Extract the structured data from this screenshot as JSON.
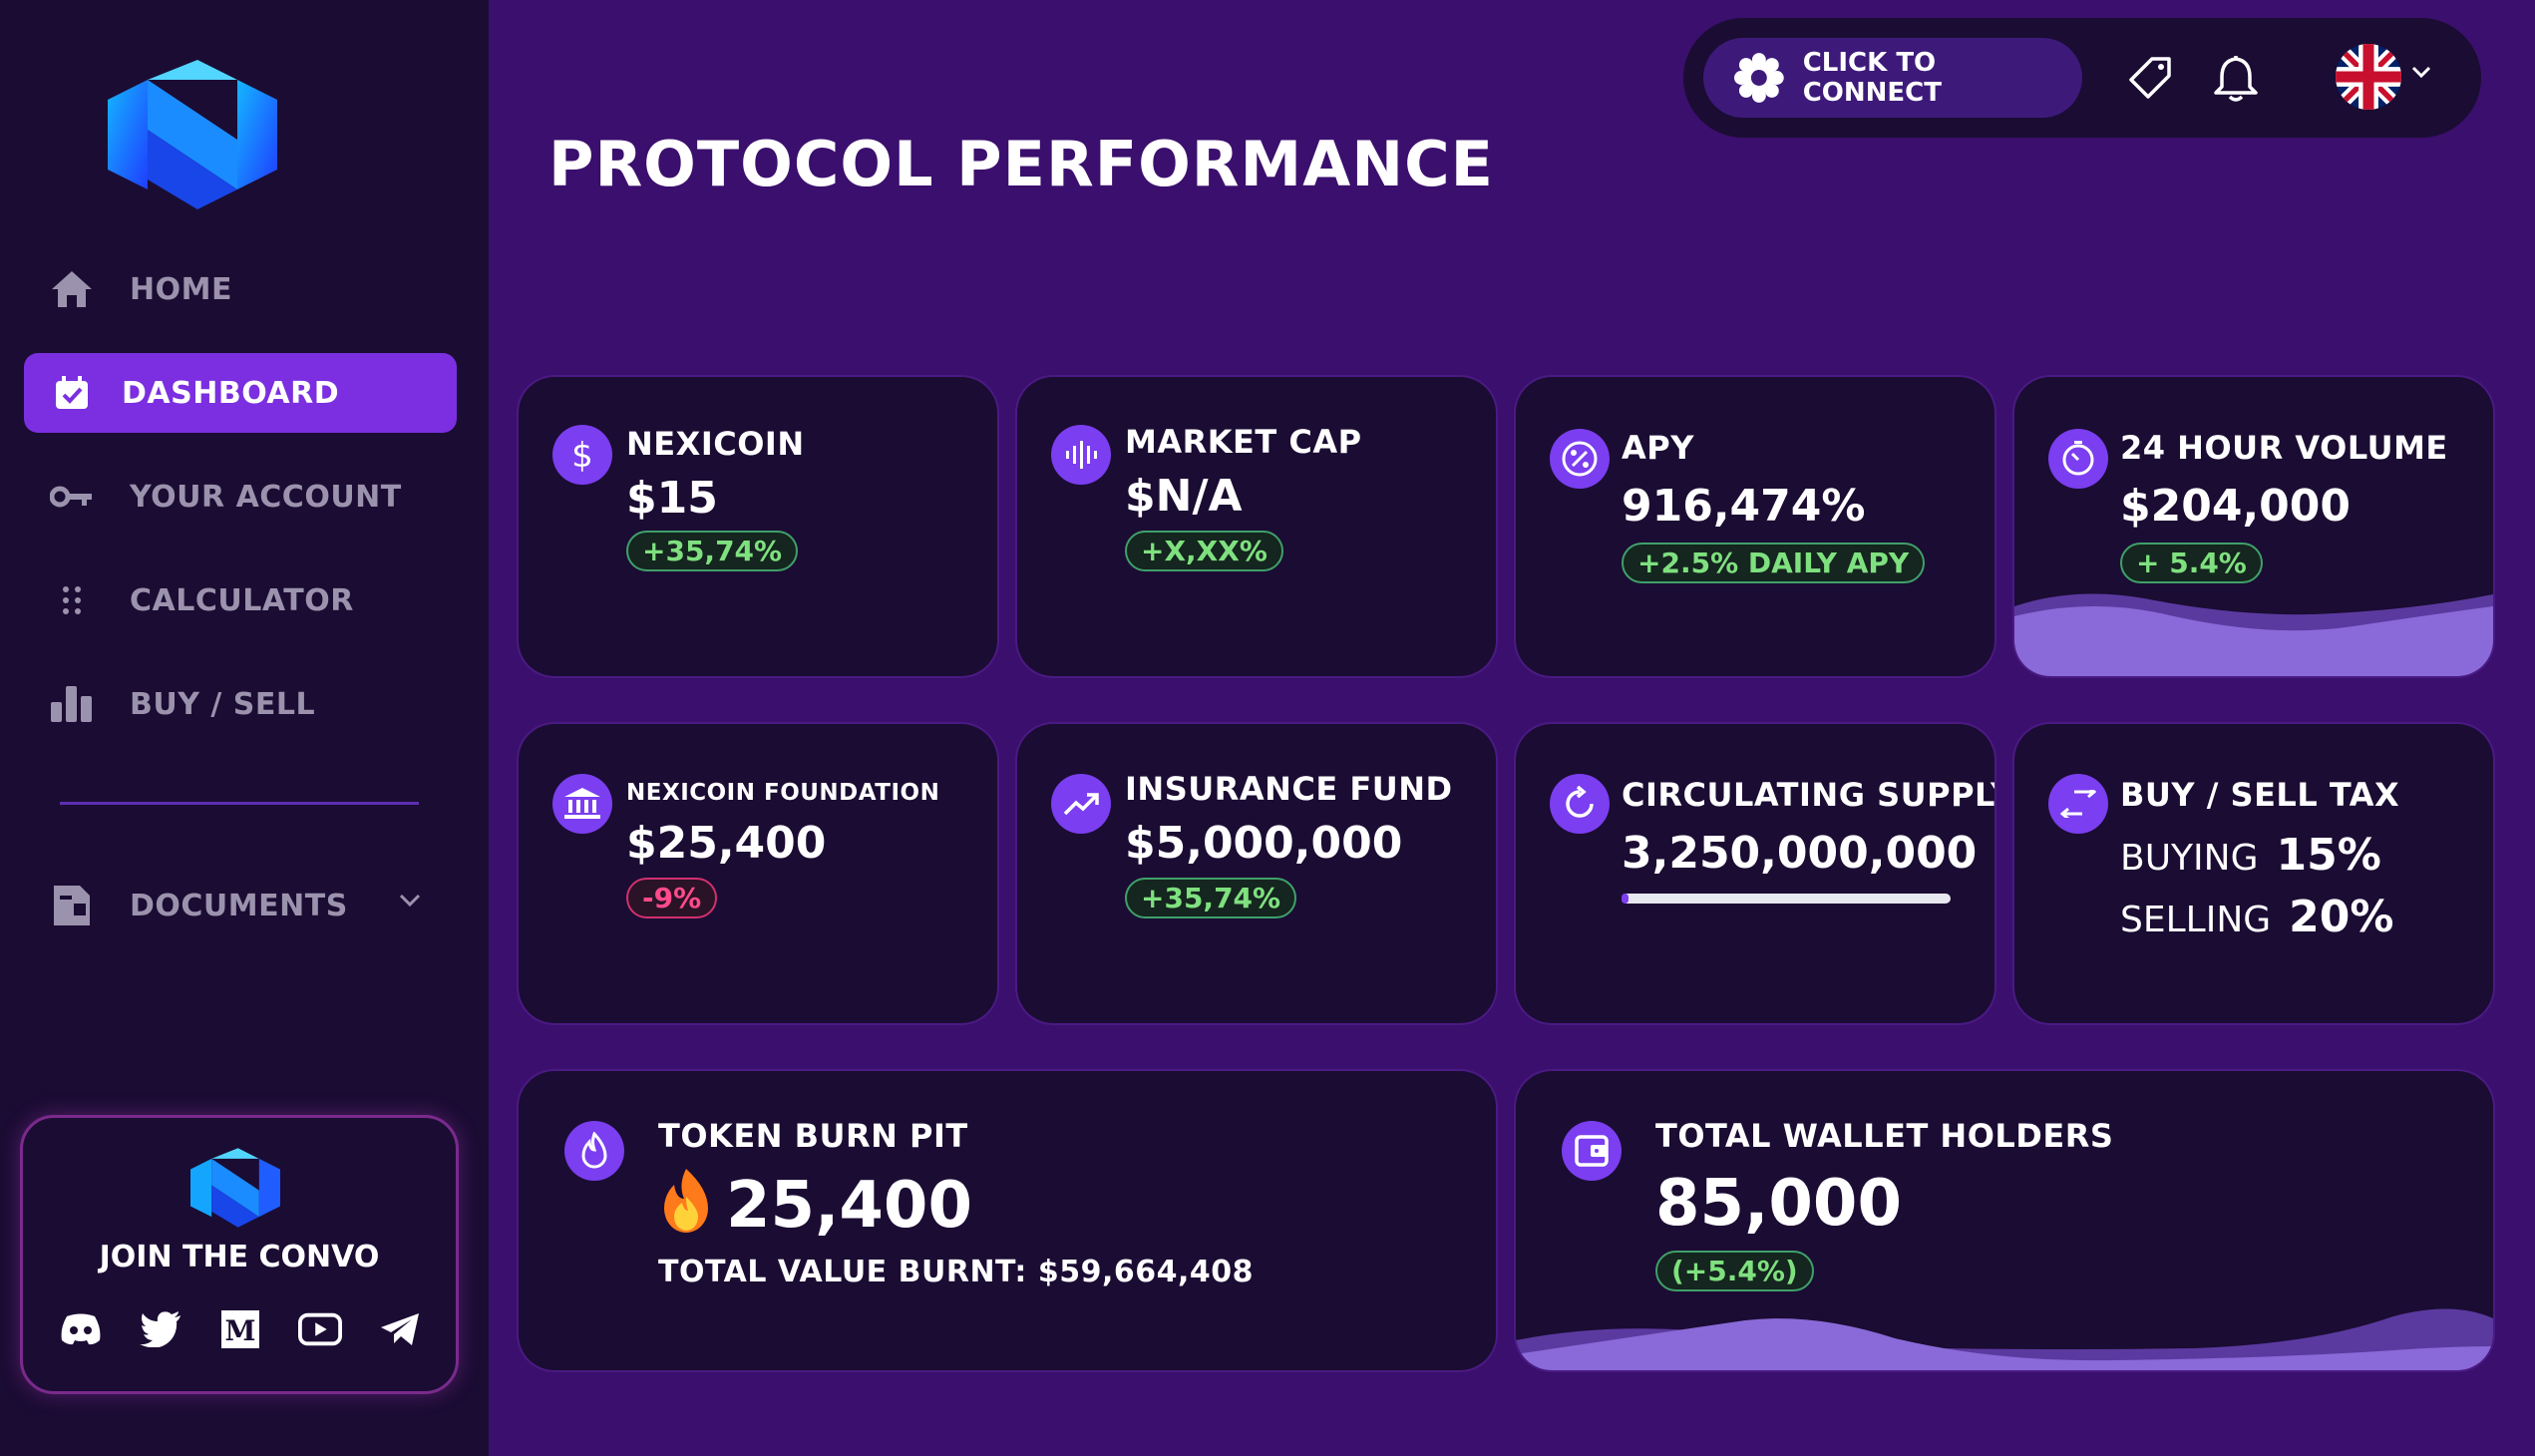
{
  "colors": {
    "background": "#3b0f6d",
    "sidebar": "#1b0c33",
    "accent": "#7b2fe0",
    "positive": "#7fe07f",
    "negative": "#ff4b8a"
  },
  "sidebar": {
    "items": [
      {
        "label": "HOME",
        "icon": "home-icon"
      },
      {
        "label": "DASHBOARD",
        "icon": "calendar-check-icon",
        "active": true
      },
      {
        "label": "YOUR ACCOUNT",
        "icon": "key-icon"
      },
      {
        "label": "CALCULATOR",
        "icon": "dots-grid-icon"
      },
      {
        "label": "BUY / SELL",
        "icon": "bar-chart-icon"
      }
    ],
    "documents": {
      "label": "DOCUMENTS",
      "icon": "document-icon"
    },
    "convo": {
      "title": "JOIN THE CONVO",
      "socials": [
        "discord-icon",
        "twitter-icon",
        "medium-icon",
        "youtube-icon",
        "telegram-icon"
      ]
    }
  },
  "topbar": {
    "connect_label": "CLICK TO CONNECT",
    "icons": [
      "tag-icon",
      "bell-icon",
      "uk-flag-icon"
    ]
  },
  "page_title": "PROTOCOL PERFORMANCE",
  "cards": {
    "nexicoin": {
      "title": "NEXICOIN",
      "value": "$15",
      "change": "+35,74%"
    },
    "market_cap": {
      "title": "MARKET CAP",
      "value": "$N/A",
      "change": "+X,XX%"
    },
    "apy": {
      "title": "APY",
      "value": "916,474%",
      "change": "+2.5% DAILY APY"
    },
    "volume": {
      "title": "24 HOUR VOLUME",
      "value": "$204,000",
      "change": "+ 5.4%"
    },
    "foundation": {
      "title": "NEXICOIN FOUNDATION",
      "value": "$25,400",
      "change": "-9%"
    },
    "insurance": {
      "title": "INSURANCE FUND",
      "value": "$5,000,000",
      "change": "+35,74%"
    },
    "supply": {
      "title": "CIRCULATING SUPPLY",
      "value": "3,250,000,000",
      "progress": 0.02
    },
    "tax": {
      "title": "BUY / SELL TAX",
      "buying_label": "BUYING",
      "buying_value": "15%",
      "selling_label": "SELLING",
      "selling_value": "20%"
    },
    "burn": {
      "title": "TOKEN BURN PIT",
      "value": "25,400",
      "subtitle": "TOTAL VALUE BURNT: $59,664,408"
    },
    "holders": {
      "title": "TOTAL WALLET HOLDERS",
      "value": "85,000",
      "change": "(+5.4%)"
    }
  }
}
